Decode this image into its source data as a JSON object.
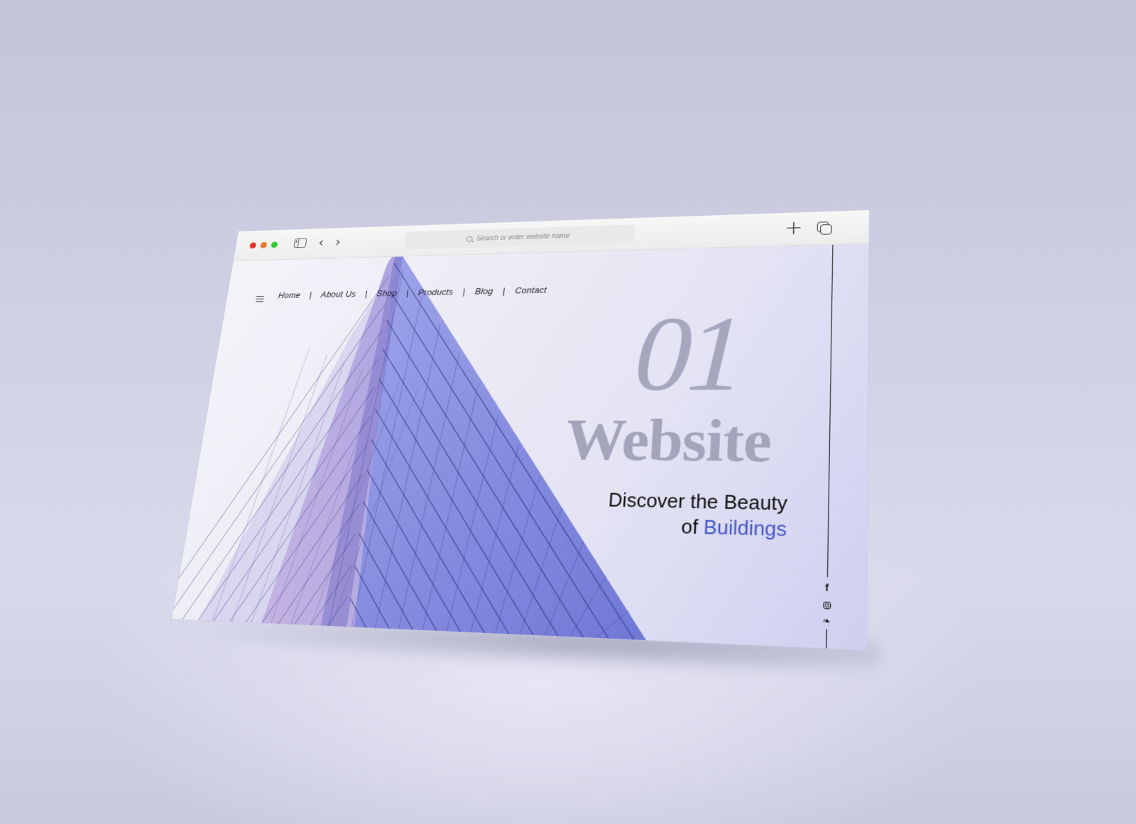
{
  "browser": {
    "traffic_lights": {
      "close": "#e8302b",
      "minimize": "#f0782a",
      "maximize": "#35c934"
    },
    "sidebar_toggle_icon": "sidebar-icon",
    "back_icon": "‹",
    "forward_icon": "›",
    "address_bar": {
      "placeholder": "Search or enter website name",
      "icon": "search-icon"
    },
    "new_tab_icon": "+",
    "tabs_overview_icon": "tabs-icon"
  },
  "site": {
    "menu_icon": "hamburger-icon",
    "nav": [
      {
        "label": "Home"
      },
      {
        "label": "About Us"
      },
      {
        "label": "Shop"
      },
      {
        "label": "Products"
      },
      {
        "label": "Blog"
      },
      {
        "label": "Contact"
      }
    ],
    "nav_separator": "|",
    "hero": {
      "number": "01",
      "word": "Website",
      "tagline_line1": "Discover the Beauty",
      "tagline_line2_prefix": "of ",
      "tagline_line2_accent": "Buildings",
      "accent_color": "#4656c8"
    },
    "social": [
      {
        "name": "facebook",
        "glyph": "f"
      },
      {
        "name": "instagram",
        "glyph": ""
      },
      {
        "name": "twitter",
        "glyph": "🐦"
      }
    ]
  },
  "colors": {
    "background": "#c6c6dc",
    "building": "#6d74d6"
  }
}
